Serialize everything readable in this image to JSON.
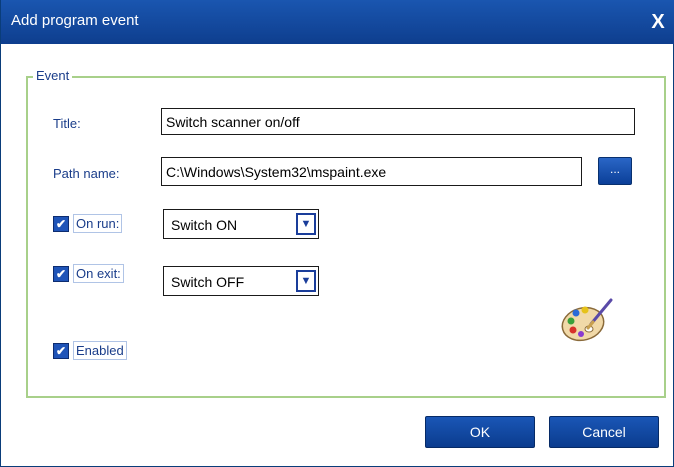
{
  "window": {
    "title": "Add program event",
    "close_glyph": "X"
  },
  "group": {
    "legend": "Event"
  },
  "fields": {
    "title_label": "Title:",
    "title_value": "Switch scanner on/off",
    "path_label": "Path name:",
    "path_value": "C:\\Windows\\System32\\mspaint.exe",
    "browse_label": "..."
  },
  "on_run": {
    "label": "On run:",
    "checked": true,
    "value": "Switch ON"
  },
  "on_exit": {
    "label": "On exit:",
    "checked": true,
    "value": "Switch OFF"
  },
  "enabled": {
    "label": "Enabled",
    "checked": true
  },
  "icons": {
    "program_icon": "paint-palette-icon",
    "dropdown": "chevron-down-icon",
    "check": "checkmark-icon"
  },
  "buttons": {
    "ok": "OK",
    "cancel": "Cancel"
  },
  "colors": {
    "titlebar": "#0e3e8e",
    "accent": "#1f54b8",
    "group_border": "#a8d08a",
    "label_text": "#1a3d8a"
  }
}
